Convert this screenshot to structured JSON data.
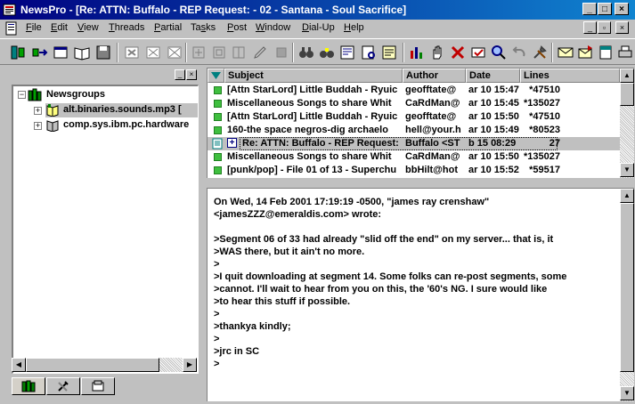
{
  "window": {
    "title": "NewsPro - [Re: ATTN: Buffalo - REP Request: - 02 - Santana - Soul Sacrifice]",
    "minimize": "_",
    "maximize": "□",
    "close": "×"
  },
  "menu": {
    "items": [
      {
        "pre": "",
        "u": "F",
        "post": "ile"
      },
      {
        "pre": "",
        "u": "E",
        "post": "dit"
      },
      {
        "pre": "",
        "u": "V",
        "post": "iew"
      },
      {
        "pre": "",
        "u": "T",
        "post": "hreads"
      },
      {
        "pre": "",
        "u": "P",
        "post": "artial"
      },
      {
        "pre": "Ta",
        "u": "s",
        "post": "ks"
      },
      {
        "pre": "",
        "u": "P",
        "post": "ost"
      },
      {
        "pre": "",
        "u": "W",
        "post": "indow"
      },
      {
        "pre": "",
        "u": "D",
        "post": "ial-Up"
      },
      {
        "pre": "",
        "u": "H",
        "post": "elp"
      }
    ]
  },
  "tree": {
    "root": "Newsgroups",
    "groups": [
      "alt.binaries.sounds.mp3  [",
      "comp.sys.ibm.pc.hardware"
    ]
  },
  "list": {
    "columns": [
      "Subject",
      "Author",
      "Date",
      "Lines"
    ],
    "rows": [
      {
        "subject": "[Attn StarLord] Little Buddah - Ryuic",
        "author": "geofftate@",
        "date": "ar 10 15:47",
        "lines": "*47510"
      },
      {
        "subject": "Miscellaneous Songs to share Whit",
        "author": "CaRdMan@",
        "date": "ar 10 15:45",
        "lines": "*135027"
      },
      {
        "subject": "[Attn StarLord] Little Buddah - Ryuic",
        "author": "geofftate@",
        "date": "ar 10 15:50",
        "lines": "*47510"
      },
      {
        "subject": "160-the space negros-dig archaelo",
        "author": "hell@your.h",
        "date": "ar 10 15:49",
        "lines": "*80523"
      },
      {
        "subject": "Re: ATTN: Buffalo - REP Request:",
        "author": "Buffalo <ST",
        "date": "b 15 08:29",
        "lines": "27"
      },
      {
        "subject": "Miscellaneous Songs to share Whit",
        "author": "CaRdMan@",
        "date": "ar 10 15:50",
        "lines": "*135027"
      },
      {
        "subject": "[punk/pop] - File 01 of 13 - Superchu",
        "author": "bbHilt@hot",
        "date": "ar 10 15:52",
        "lines": "*59517"
      }
    ]
  },
  "message": {
    "lines": [
      "On Wed, 14 Feb 2001 17:19:19 -0500, \"james ray crenshaw\"",
      "<jamesZZZ@emeraldis.com> wrote:",
      "",
      ">Segment 06 of 33 had already \"slid off the end\" on my server... that is, it",
      ">WAS there, but it ain't no more.",
      ">",
      ">I quit downloading at segment 14. Some folks can re-post segments, some",
      ">cannot. I'll wait to hear from you on this, the '60's NG. I sure would like",
      ">to hear this stuff if possible.",
      ">",
      ">thankya kindly;",
      ">",
      ">jrc in SC",
      ">"
    ]
  },
  "colors": {
    "title_start": "#000080",
    "title_end": "#1084d0",
    "unread": "#3fbf3f",
    "selected_row": "#c0c0c0"
  }
}
